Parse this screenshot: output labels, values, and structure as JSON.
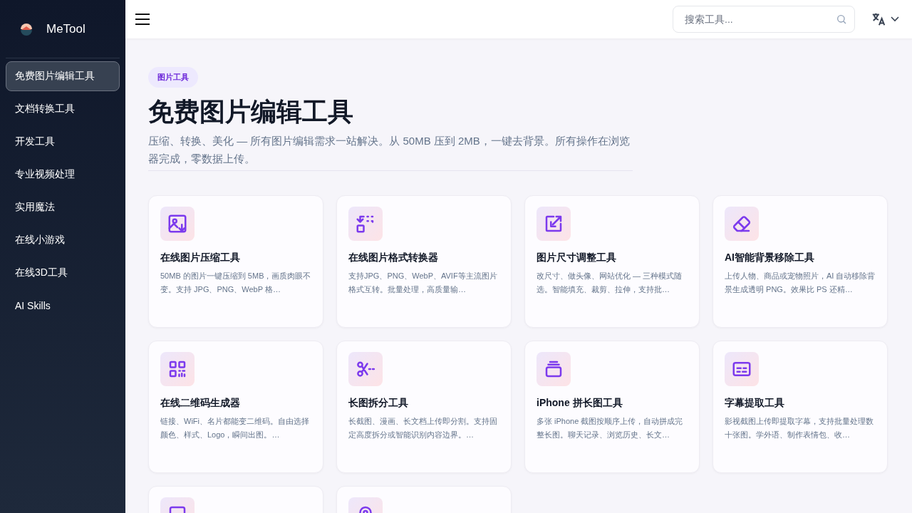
{
  "sidebar": {
    "brand": "MeTool",
    "items": [
      {
        "label": "免费图片编辑工具",
        "selected": true
      },
      {
        "label": "文档转换工具",
        "selected": false
      },
      {
        "label": "开发工具",
        "selected": false
      },
      {
        "label": "专业视频处理",
        "selected": false
      },
      {
        "label": "实用魔法",
        "selected": false
      },
      {
        "label": "在线小游戏",
        "selected": false
      },
      {
        "label": "在线3D工具",
        "selected": false
      },
      {
        "label": "AI Skills",
        "selected": false
      }
    ]
  },
  "header": {
    "search": {
      "placeholder": "搜索工具..."
    }
  },
  "page": {
    "badge": "图片工具",
    "title": "免费图片编辑工具",
    "description": "压缩、转换、美化 — 所有图片编辑需求一站解决。从 50MB 压到 2MB，一键去背景。所有操作在浏览器完成，零数据上传。"
  },
  "cards": [
    {
      "kind": "full",
      "title": "在线图片压缩工具",
      "description": "50MB 的图片一键压缩到 5MB，画质肉眼不变。支持 JPG、PNG、WebP 格…"
    },
    {
      "kind": "full",
      "title": "在线图片格式转换器",
      "description": "支持JPG、PNG、WebP、AVIF等主流图片格式互转。批量处理，高质量输…"
    },
    {
      "kind": "full",
      "title": "图片尺寸调整工具",
      "description": "改尺寸、做头像、网站优化 — 三种模式随选。智能填充、裁剪、拉伸，支持批…"
    },
    {
      "kind": "full",
      "title": "AI智能背景移除工具",
      "description": "上传人物、商品或宠物照片，AI 自动移除背景生成透明 PNG。效果比 PS 还精…"
    },
    {
      "kind": "full",
      "title": "在线二维码生成器",
      "description": "链接、WiFi、名片都能变二维码。自由选择颜色、样式、Logo，瞬间出图。…"
    },
    {
      "kind": "full",
      "title": "长图拆分工具",
      "description": "长截图、漫画、长文档上传即分割。支持固定高度拆分或智能识别内容边界。…"
    },
    {
      "kind": "full",
      "title": "iPhone 拼长图工具",
      "description": "多张 iPhone 截图按顺序上传，自动拼成完整长图。聊天记录、浏览历史、长文…"
    },
    {
      "kind": "full",
      "title": "字幕提取工具",
      "description": "影视截图上传即提取字幕，支持批量处理数十张图。学外语、制作表情包、收…"
    },
    {
      "kind": "cut"
    },
    {
      "kind": "cut"
    }
  ]
}
